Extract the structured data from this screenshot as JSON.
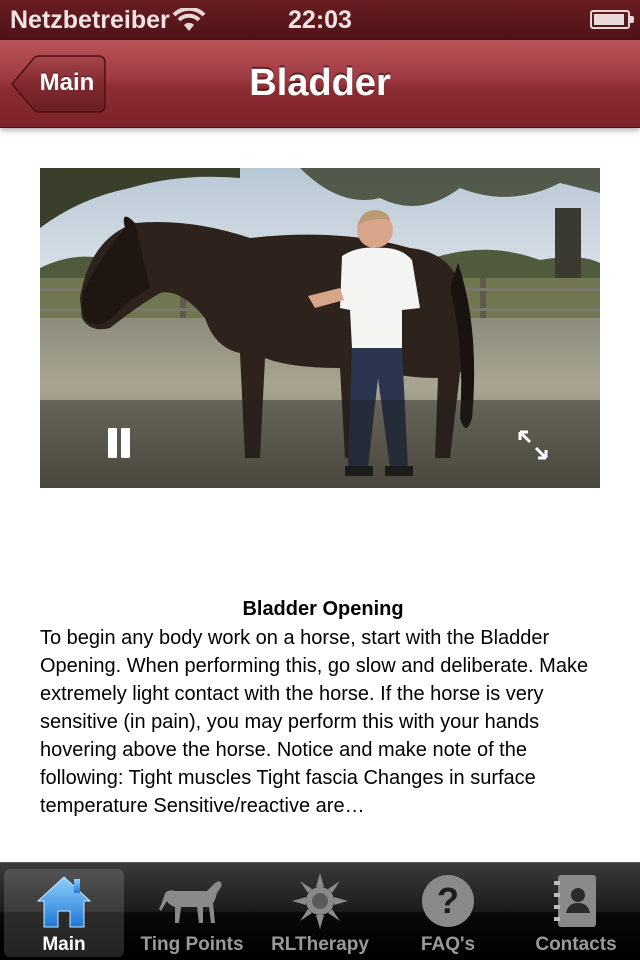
{
  "status_bar": {
    "carrier": "Netzbetreiber",
    "time": "22:03"
  },
  "nav": {
    "back_label": "Main",
    "title": "Bladder"
  },
  "video": {
    "state": "playing"
  },
  "content": {
    "title": "Bladder Opening",
    "body": "To begin any body work on a horse, start with the Bladder Opening. When performing this, go slow and deliberate. Make extremely light contact with the horse. If the horse is very sensitive (in pain), you may perform this with your hands hovering above the horse. Notice and make note of the following: Tight muscles Tight fascia Changes in surface temperature Sensitive/reactive are…"
  },
  "tabs": [
    {
      "label": "Main",
      "icon": "house-icon",
      "selected": true
    },
    {
      "label": "Ting Points",
      "icon": "horse-icon",
      "selected": false
    },
    {
      "label": "RLTherapy",
      "icon": "sun-icon",
      "selected": false
    },
    {
      "label": "FAQ's",
      "icon": "question-icon",
      "selected": false
    },
    {
      "label": "Contacts",
      "icon": "contacts-book-icon",
      "selected": false
    }
  ],
  "colors": {
    "nav_bar": "#9e3a41",
    "status_bar": "#5a181c",
    "tab_bar": "#111111",
    "tab_selected_icon": "#3f9ae6"
  }
}
